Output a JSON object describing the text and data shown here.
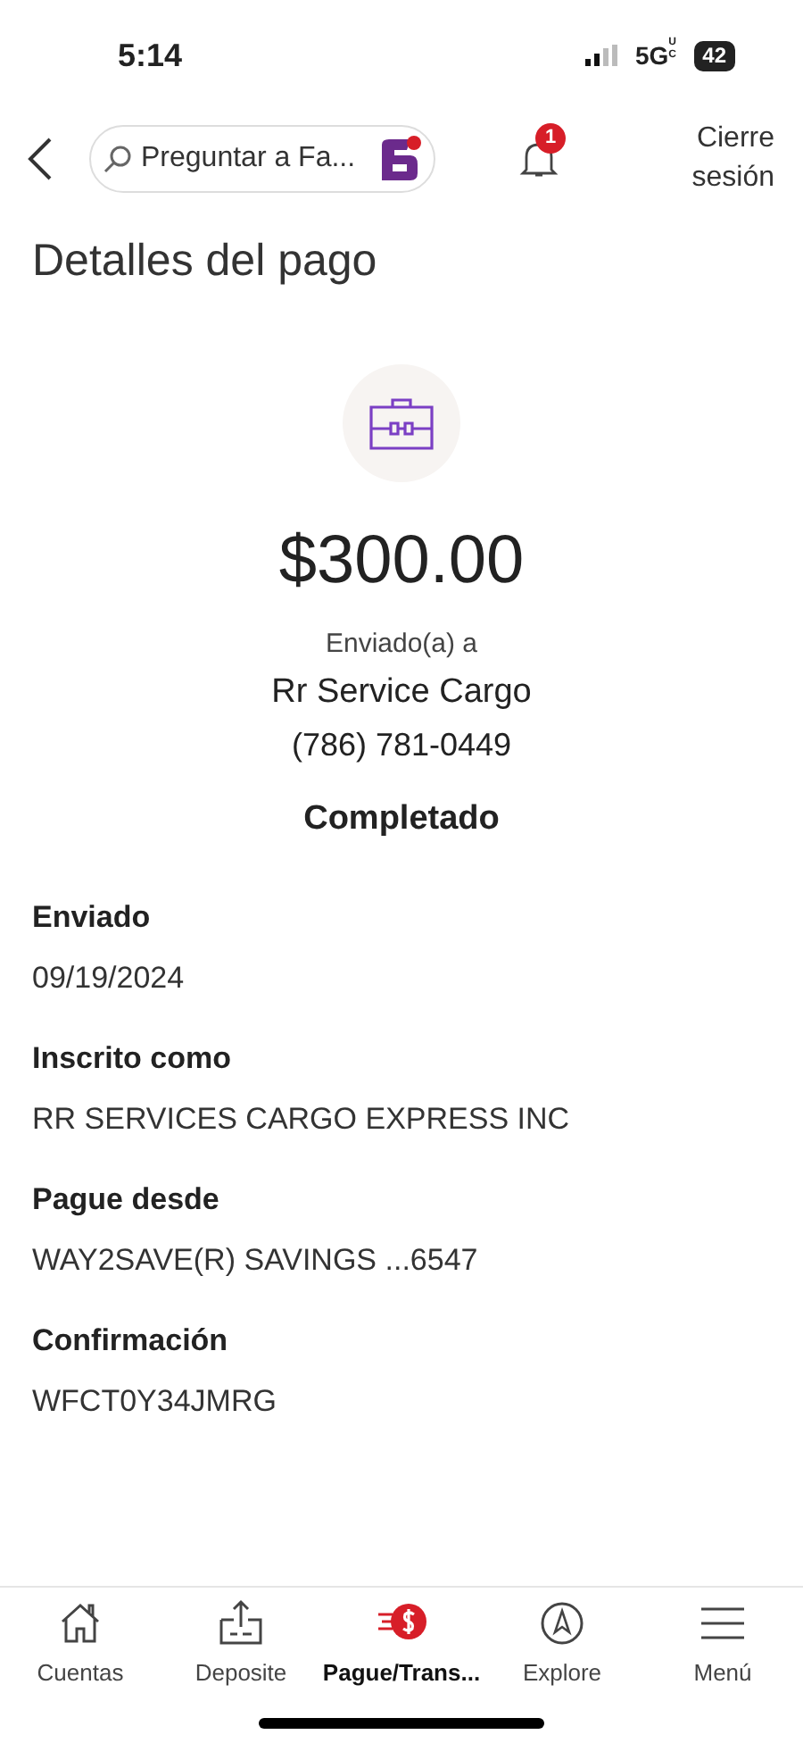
{
  "status_bar": {
    "time": "5:14",
    "network": "5G",
    "network_suffix": "UC",
    "battery": "42"
  },
  "header": {
    "search": {
      "placeholder": "Preguntar a Fa..."
    },
    "notification_count": "1",
    "logout": "Cierre sesión"
  },
  "title": "Detalles del pago",
  "payment": {
    "amount": "$300.00",
    "sent_to_label": "Enviado(a) a",
    "recipient": "Rr Service Cargo",
    "phone": "(786) 781-0449",
    "status": "Completado"
  },
  "details": [
    {
      "label": "Enviado",
      "value": "09/19/2024"
    },
    {
      "label": "Inscrito como",
      "value": "RR SERVICES CARGO EXPRESS INC"
    },
    {
      "label": "Pague desde",
      "value": "WAY2SAVE(R) SAVINGS ...6547"
    },
    {
      "label": "Confirmación",
      "value": "WFCT0Y34JMRG"
    }
  ],
  "tab_bar": [
    {
      "kind": "home",
      "label": "Cuentas",
      "selected": false
    },
    {
      "kind": "deposit",
      "label": "Deposite",
      "selected": false
    },
    {
      "kind": "pay",
      "label": "Pague/Trans...",
      "selected": true
    },
    {
      "kind": "explore",
      "label": "Explore",
      "selected": false
    },
    {
      "kind": "menu",
      "label": "Menú",
      "selected": false
    }
  ]
}
